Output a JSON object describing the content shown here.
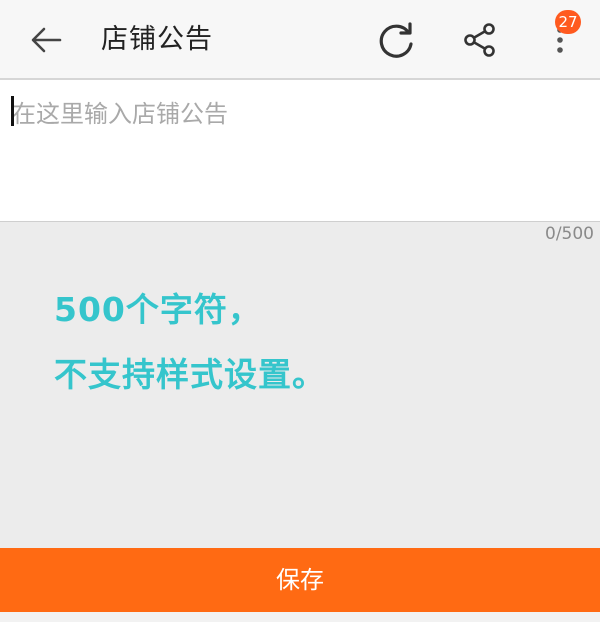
{
  "header": {
    "title": "店铺公告",
    "notification_count": "27",
    "icons": {
      "back": "back-arrow-icon",
      "refresh": "refresh-icon",
      "share": "share-icon",
      "more": "more-vertical-icon"
    }
  },
  "editor": {
    "value": "",
    "placeholder": "在这里输入店铺公告",
    "char_count": "0/500"
  },
  "hint": {
    "line1": "500个字符，",
    "line2": "不支持样式设置。",
    "color": "#35c5cc"
  },
  "footer": {
    "save_label": "保存",
    "accent": "#ff6a13"
  }
}
